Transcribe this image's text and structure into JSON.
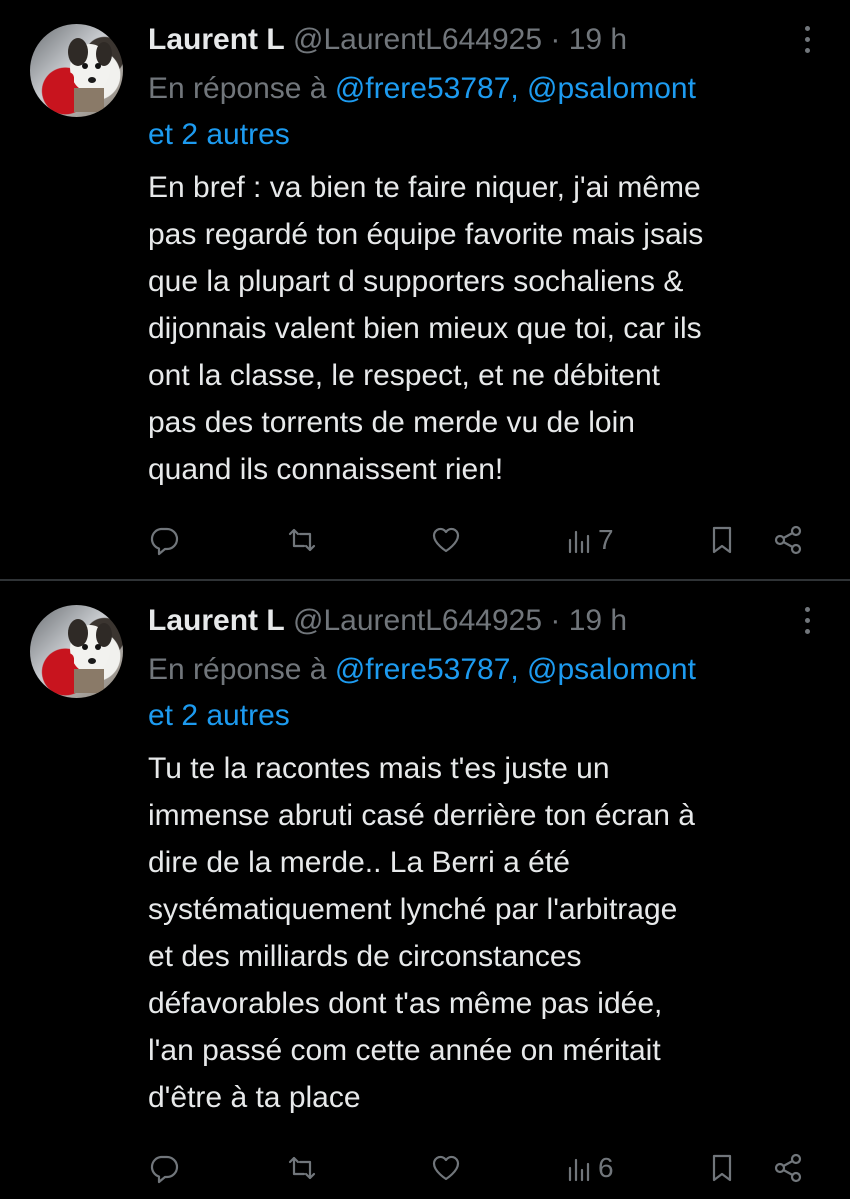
{
  "tweets": [
    {
      "author": {
        "name": "Laurent L",
        "handle": "@LaurentL644925",
        "separator": "·",
        "time": "19 h"
      },
      "reply": {
        "prefix": "En réponse à",
        "mentions": "@frere53787, @psalomont",
        "others": "et 2 autres"
      },
      "text": "En bref : va bien te faire niquer, j'ai même\npas regardé ton équipe favorite mais jsais\nque la plupart d supporters sochaliens &\ndijonnais valent bien mieux que toi, car ils\nont la classe, le respect, et ne débitent\npas des torrents de merde vu de loin\nquand ils connaissent rien!",
      "views": "7"
    },
    {
      "author": {
        "name": "Laurent L",
        "handle": "@LaurentL644925",
        "separator": "·",
        "time": "19 h"
      },
      "reply": {
        "prefix": "En réponse à",
        "mentions": "@frere53787, @psalomont",
        "others": "et 2 autres"
      },
      "text": "Tu te la racontes mais t'es juste un\nimmense abruti casé derrière ton écran à\ndire de la merde.. La Berri a été\nsystématiquement lynché par l'arbitrage\net des milliards de circonstances\ndéfavorables dont t'as même pas idée,\nl'an passé com cette année on méritait\nd'être à ta place",
      "views": "6"
    }
  ],
  "icons": {
    "reply": "reply-icon",
    "retweet": "retweet-icon",
    "like": "heart-icon",
    "views": "views-icon",
    "bookmark": "bookmark-icon",
    "share": "share-icon",
    "more": "more-icon"
  },
  "colors": {
    "background": "#000000",
    "text": "#e7e9ea",
    "muted": "#71767b",
    "link": "#1d9bf0",
    "divider": "#2f3336"
  }
}
